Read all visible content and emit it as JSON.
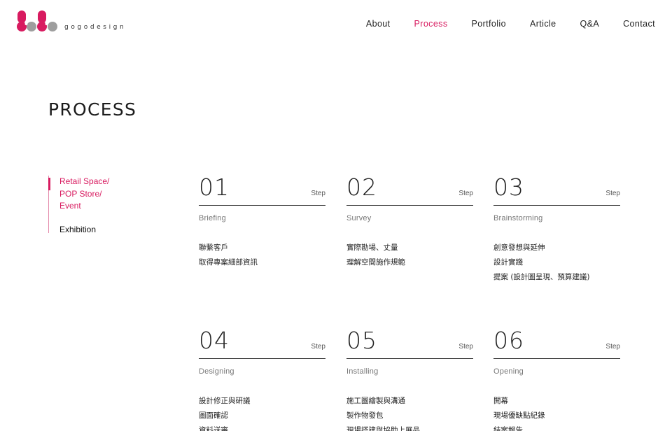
{
  "brand": {
    "name": "gogodesign",
    "colors": {
      "accent": "#d81b60",
      "grey": "#9e9e9e"
    }
  },
  "nav": {
    "items": [
      {
        "label": "About",
        "active": false
      },
      {
        "label": "Process",
        "active": true
      },
      {
        "label": "Portfolio",
        "active": false
      },
      {
        "label": "Article",
        "active": false
      },
      {
        "label": "Q&A",
        "active": false
      },
      {
        "label": "Contact",
        "active": false
      }
    ]
  },
  "page": {
    "title": "PROCESS"
  },
  "sidebar": {
    "items": [
      {
        "label": "Retail Space/ POP Store/ Event",
        "active": true
      },
      {
        "label": "Exhibition",
        "active": false
      }
    ]
  },
  "steps": [
    {
      "number": "01",
      "label": "Step",
      "title": "Briefing",
      "lines": [
        "聯繫客戶",
        "取得專案細部資訊"
      ]
    },
    {
      "number": "02",
      "label": "Step",
      "title": "Survey",
      "lines": [
        "實際勘場、丈量",
        "理解空間施作規範"
      ]
    },
    {
      "number": "03",
      "label": "Step",
      "title": "Brainstorming",
      "lines": [
        "創意發想與延伸",
        "設計實踐",
        "提案 (設計圖呈現、預算建議)"
      ]
    },
    {
      "number": "04",
      "label": "Step",
      "title": "Designing",
      "lines": [
        "設計修正與研議",
        "圖面確認",
        "資料送審"
      ]
    },
    {
      "number": "05",
      "label": "Step",
      "title": "Installing",
      "lines": [
        "施工圖繪製與溝通",
        "製作物發包",
        "現場搭建與協助上展品"
      ]
    },
    {
      "number": "06",
      "label": "Step",
      "title": "Opening",
      "lines": [
        "開幕",
        "現場優缺點紀錄",
        "結案報告"
      ]
    }
  ]
}
